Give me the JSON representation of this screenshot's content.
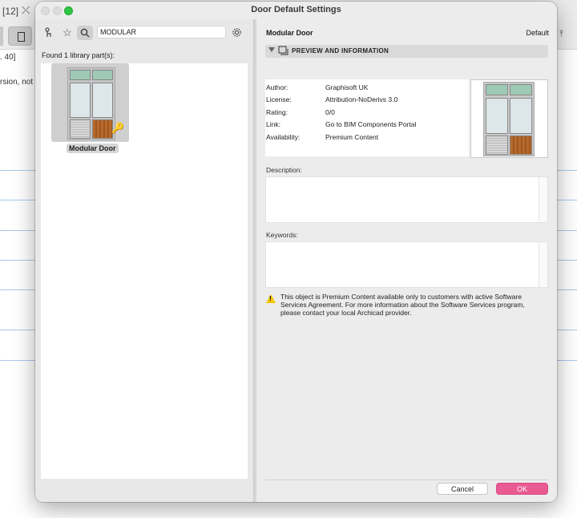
{
  "background_app": {
    "toolbar_text_1": "[12]",
    "toolbar_text_2": ". 40]",
    "body_text": "rsion, not fo"
  },
  "dialog": {
    "title": "Door Default Settings"
  },
  "left_pane": {
    "search_value": "MODULAR",
    "found_text": "Found 1 library part(s):",
    "parts": [
      {
        "label": "Modular Door"
      }
    ]
  },
  "right_pane": {
    "part_title": "Modular Door",
    "default_label": "Default",
    "section_label": "PREVIEW AND INFORMATION",
    "info": {
      "author_key": "Author:",
      "author_val": "Graphisoft UK",
      "license_key": "License:",
      "license_val": "Attribution-NoDerivs 3.0",
      "rating_key": "Rating:",
      "rating_val": "0/0",
      "link_key": "Link:",
      "link_val": "Go to BIM Components Portal",
      "availability_key": "Availability:",
      "availability_val": "Premium Content"
    },
    "description_label": "Description:",
    "keywords_label": "Keywords:",
    "warning_text": "This object is Premium Content available only to customers with active Software Services Agreement. For more information about the Software Services program, please contact your local Archicad provider."
  },
  "buttons": {
    "cancel": "Cancel",
    "ok": "OK"
  },
  "colors": {
    "ok_button": "#ea5a92",
    "window_close": "#dcdcdc",
    "window_max": "#2cc840"
  },
  "icons": [
    "library-icon",
    "favorites-star-icon",
    "search-icon",
    "settings-gear-icon",
    "key-icon",
    "preview-icon",
    "warning-icon"
  ]
}
